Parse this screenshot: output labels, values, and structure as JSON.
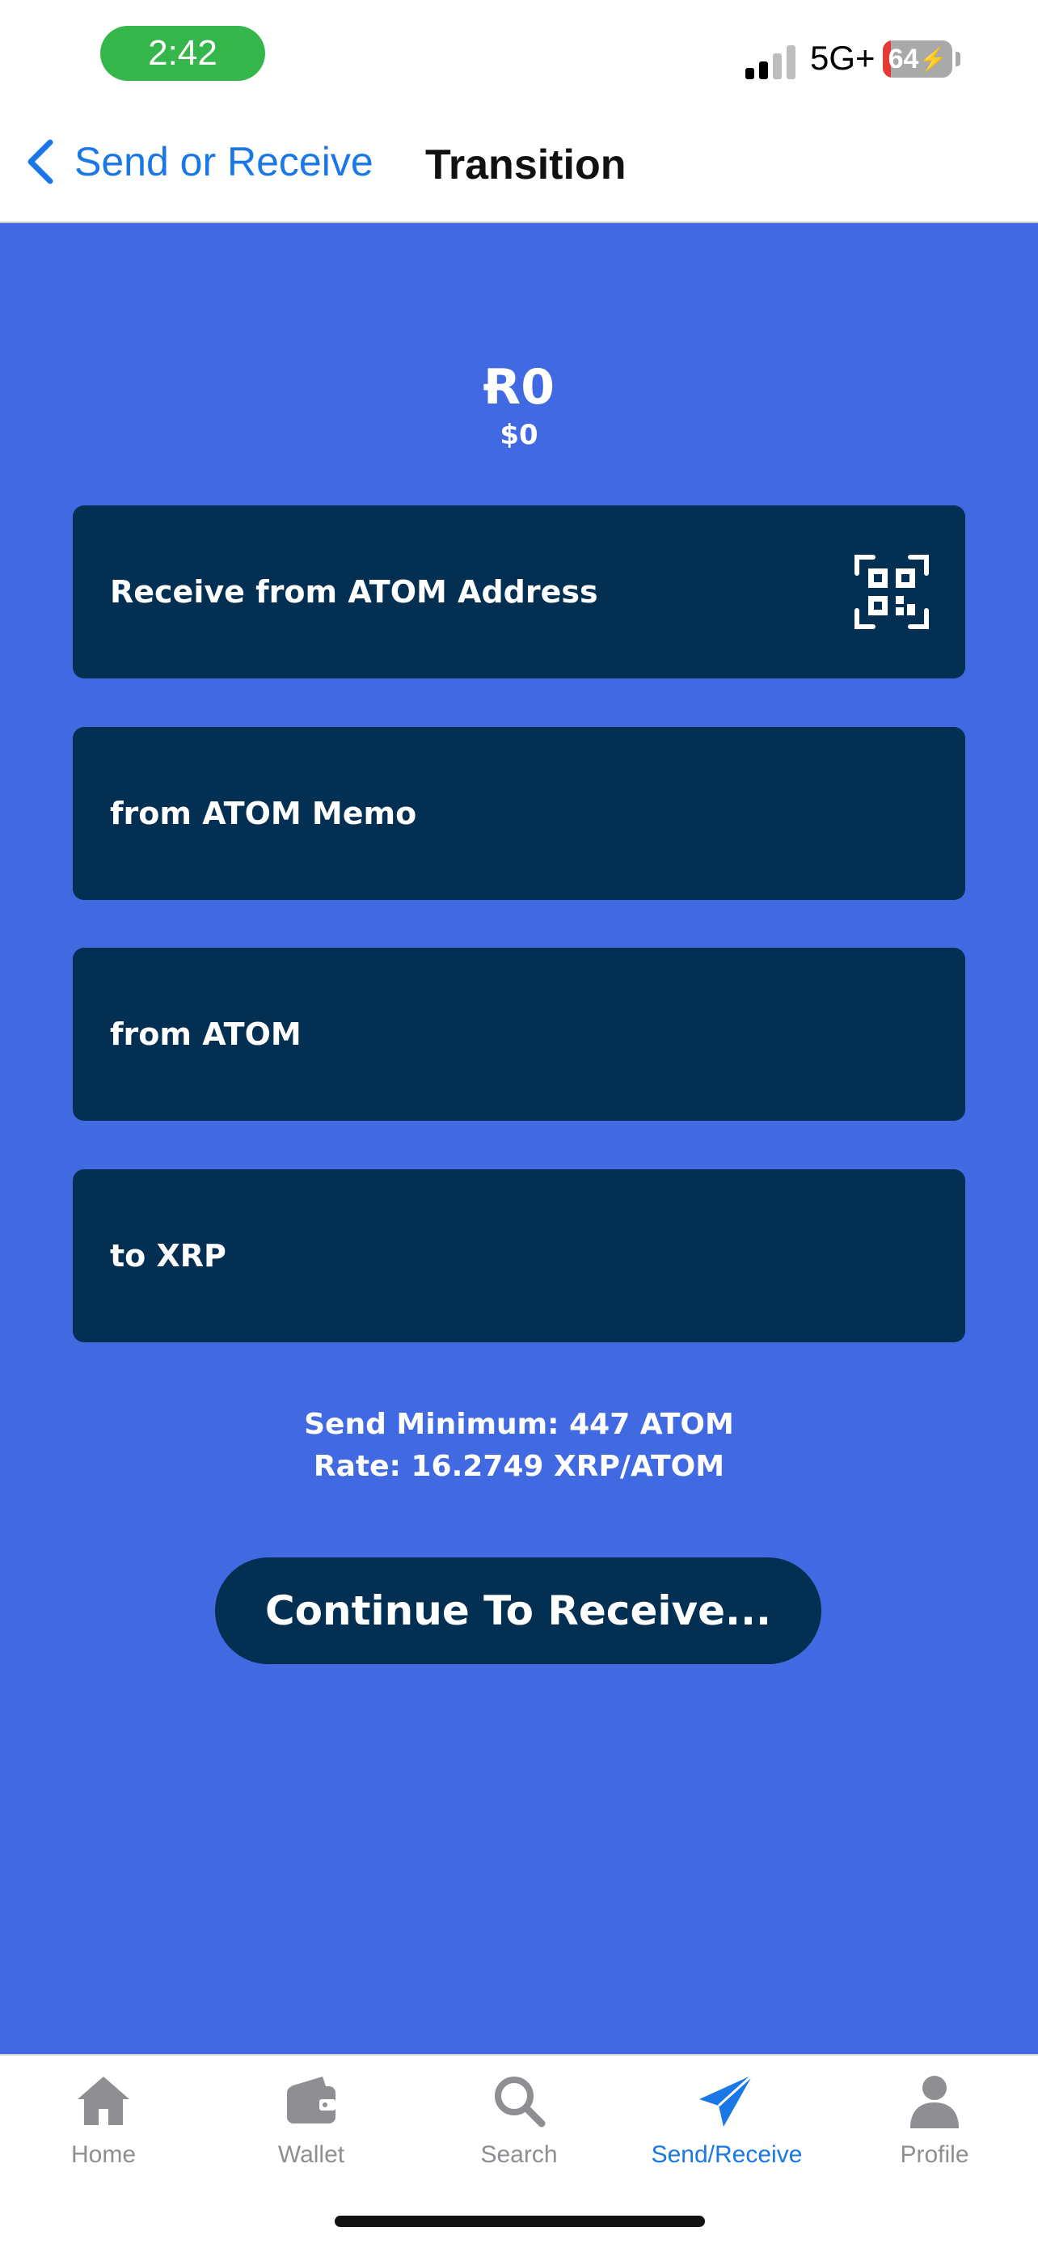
{
  "status_bar": {
    "time": "2:42",
    "network": "5G+",
    "battery": "64"
  },
  "nav": {
    "back_label": "Send or Receive",
    "title": "Transition"
  },
  "balance": {
    "amount": "Ɍ0",
    "usd": "$0"
  },
  "fields": [
    {
      "label": "Receive from ATOM Address",
      "icon": "qr-code-icon"
    },
    {
      "label": "from ATOM Memo"
    },
    {
      "label": "from ATOM"
    },
    {
      "label": "to XRP"
    }
  ],
  "info": {
    "send_minimum": "Send Minimum: 447 ATOM",
    "rate": "Rate: 16.2749 XRP/ATOM"
  },
  "continue_button": "Continue To Receive...",
  "tabs": [
    {
      "label": "Home",
      "icon": "home-icon"
    },
    {
      "label": "Wallet",
      "icon": "wallet-icon"
    },
    {
      "label": "Search",
      "icon": "search-icon"
    },
    {
      "label": "Send/Receive",
      "icon": "paper-plane-icon",
      "active": true
    },
    {
      "label": "Profile",
      "icon": "person-icon"
    }
  ],
  "colors": {
    "background": "#4169e1",
    "field": "#022f52",
    "accent": "#1a78e6",
    "time_pill": "#34b64a"
  }
}
